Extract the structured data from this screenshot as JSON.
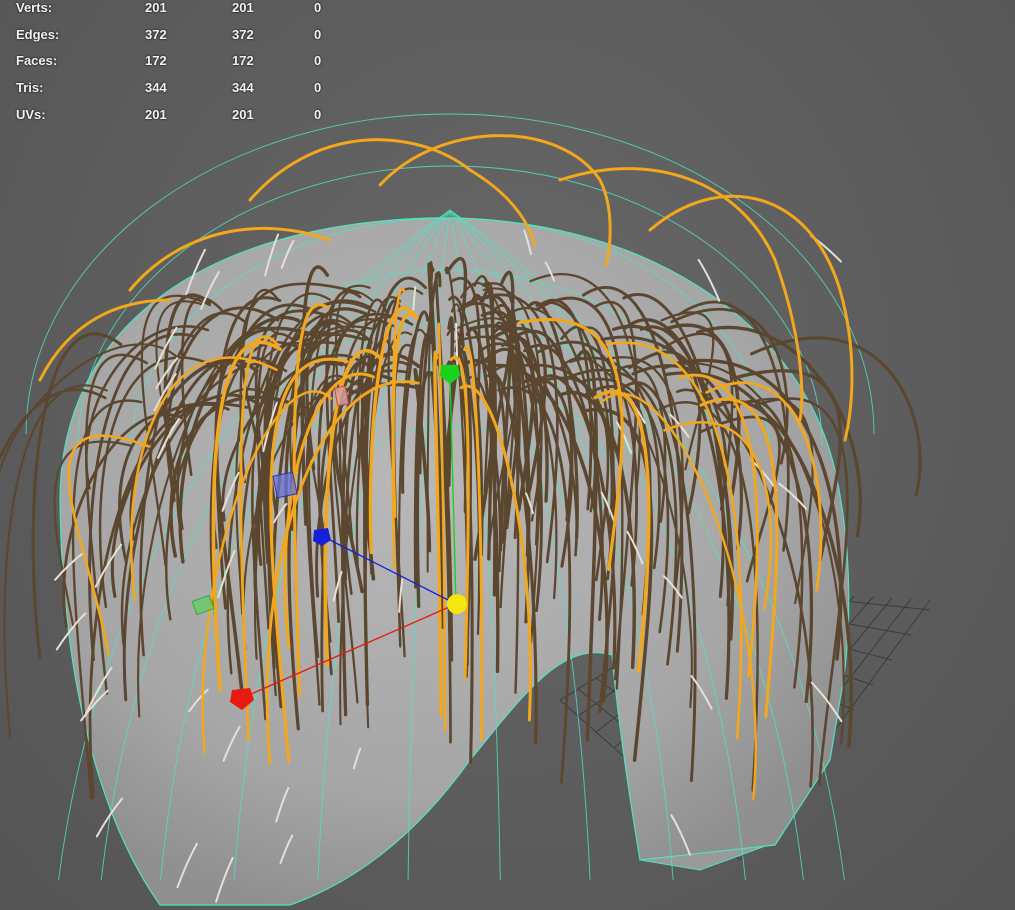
{
  "hud": {
    "rows": [
      {
        "label": "Verts:",
        "v1": "201",
        "v2": "201",
        "v3": "0"
      },
      {
        "label": "Edges:",
        "v1": "372",
        "v2": "372",
        "v3": "0"
      },
      {
        "label": "Faces:",
        "v1": "172",
        "v2": "172",
        "v3": "0"
      },
      {
        "label": "Tris:",
        "v1": "344",
        "v2": "344",
        "v3": "0"
      },
      {
        "label": "UVs:",
        "v1": "201",
        "v2": "201",
        "v3": "0"
      }
    ]
  },
  "colors": {
    "background": "#5c5c5c",
    "head_mesh": "#a9a9a9",
    "wireframe": "#4fe3c1",
    "hair_dark": "#5b4630",
    "hair_orange": "#f2a71c",
    "hair_white": "#e6dfd4",
    "grid": "#3a3a3a",
    "pivot_x": "#e61a10",
    "pivot_y": "#18d21c",
    "pivot_z": "#1520d8",
    "pivot_center": "#f5e60f"
  },
  "icons": [
    "move-pivot-manipulator-icon",
    "hair-curves-icon",
    "ground-grid-icon"
  ]
}
